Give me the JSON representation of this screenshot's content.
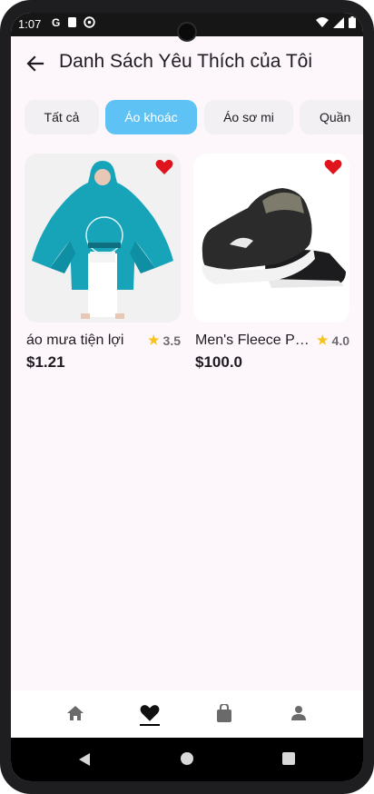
{
  "status": {
    "time": "1:07",
    "icons_left": [
      "G",
      "storage-icon",
      "at-icon"
    ],
    "icons_right": [
      "wifi-icon",
      "signal-icon",
      "battery-icon"
    ]
  },
  "header": {
    "title": "Danh Sách Yêu Thích của Tôi"
  },
  "chips": [
    {
      "label": "Tất cả",
      "active": false
    },
    {
      "label": "Áo khoác",
      "active": true
    },
    {
      "label": "Áo sơ mi",
      "active": false
    },
    {
      "label": "Quần",
      "active": false
    }
  ],
  "products": [
    {
      "name": "áo mưa tiện lợi",
      "rating": "3.5",
      "price": "$1.21",
      "favorite": true,
      "image": "green-rain-poncho"
    },
    {
      "name": "Men's Fleece Pu...",
      "rating": "4.0",
      "price": "$100.0",
      "favorite": true,
      "image": "black-sneakers"
    }
  ],
  "bottom_nav": [
    {
      "icon": "home-icon",
      "active": false
    },
    {
      "icon": "heart-icon",
      "active": true
    },
    {
      "icon": "bag-icon",
      "active": false
    },
    {
      "icon": "person-icon",
      "active": false
    }
  ],
  "colors": {
    "accent": "#5ec3f4",
    "heart": "#e0141c",
    "star": "#f7c21a",
    "background": "#fdf7fc"
  }
}
